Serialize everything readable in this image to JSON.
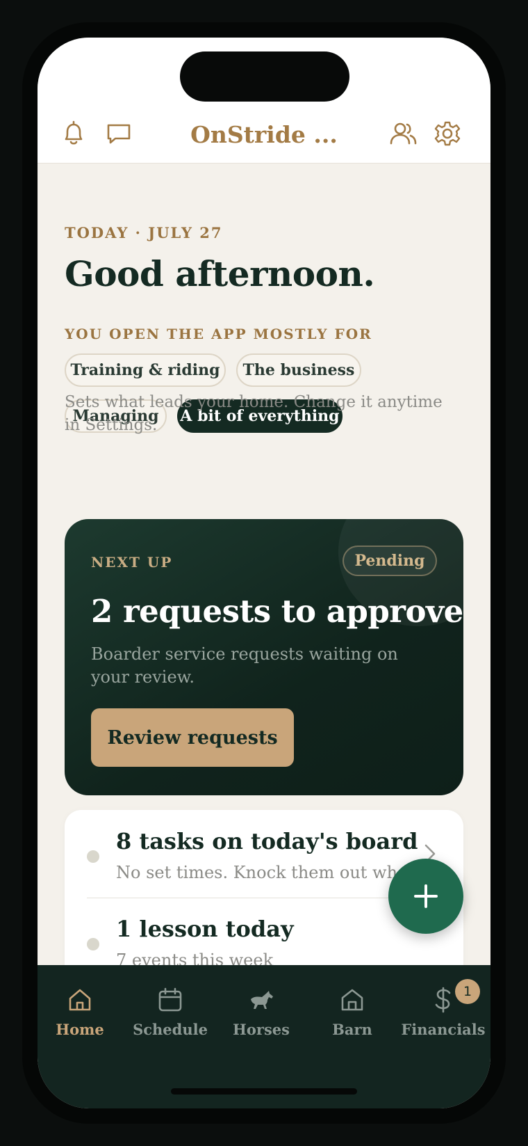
{
  "header": {
    "title": "OnStride ...",
    "icons": {
      "left": [
        "bell-icon",
        "chat-icon"
      ],
      "right": [
        "users-icon",
        "gear-icon"
      ]
    }
  },
  "today": {
    "date_label": "TODAY · JULY 27",
    "greeting": "Good afternoon.",
    "prompt": "YOU OPEN THE APP MOSTLY FOR",
    "chips": [
      {
        "label": "Training & riding",
        "active": false
      },
      {
        "label": "The business",
        "active": false
      },
      {
        "label": "Managing",
        "active": false
      },
      {
        "label": "A bit of everything",
        "active": true
      }
    ],
    "hint": "Sets what leads your home. Change it anytime in Settings."
  },
  "next_up": {
    "eyebrow": "NEXT UP",
    "status": "Pending",
    "title": "2 requests to approve",
    "subtitle": "Boarder service requests waiting on your review.",
    "button_label": "Review requests"
  },
  "summary": [
    {
      "title": "8 tasks on today's board",
      "subtitle": "No set times. Knock them out whe..."
    },
    {
      "title": "1 lesson today",
      "subtitle": "7 events this week"
    }
  ],
  "tabs": [
    {
      "label": "Home",
      "icon": "home-icon",
      "active": true
    },
    {
      "label": "Schedule",
      "icon": "calendar-icon",
      "active": false
    },
    {
      "label": "Horses",
      "icon": "horse-icon",
      "active": false
    },
    {
      "label": "Barn",
      "icon": "barn-icon",
      "active": false
    },
    {
      "label": "Financials",
      "icon": "dollar-icon",
      "active": false,
      "badge": "1"
    }
  ],
  "colors": {
    "brand": "#142a22",
    "accent": "#c9a57a",
    "fab": "#1f6a4e",
    "background": "#f4f1eb"
  }
}
